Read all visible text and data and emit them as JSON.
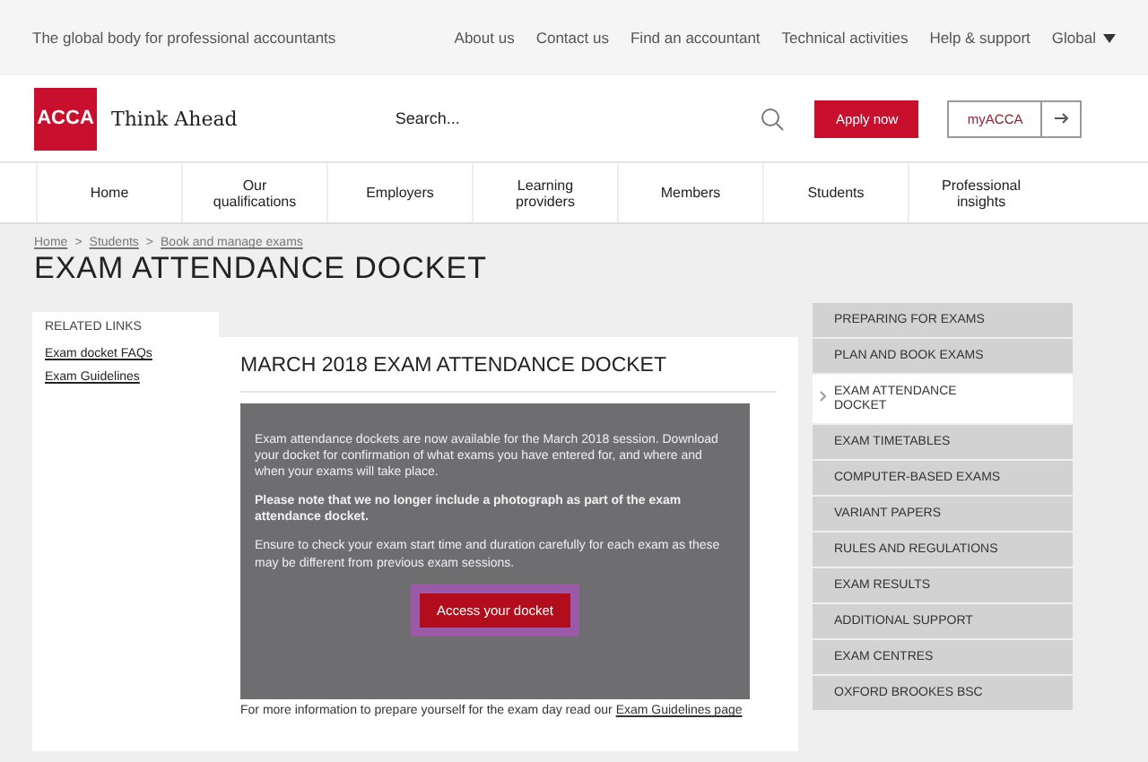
{
  "top_bar": {
    "tagline": "The global body for professional accountants",
    "links": [
      "About us",
      "Contact us",
      "Find an accountant",
      "Technical activities",
      "Help & support"
    ],
    "region": "Global"
  },
  "header": {
    "logo": "ACCA",
    "slogan": "Think Ahead",
    "search": {
      "placeholder": "Search..."
    },
    "apply_button": "Apply now",
    "account_button": "myACCA"
  },
  "nav": [
    "Home",
    "Our qualifications",
    "Employers",
    "Learning providers",
    "Members",
    "Students",
    "Professional insights"
  ],
  "breadcrumb": [
    "Home",
    "Students",
    "Book and manage exams"
  ],
  "breadcrumb_separator": ">",
  "page_title": "EXAM ATTENDANCE DOCKET",
  "related_links": {
    "title": "RELATED LINKS",
    "links": [
      "Exam docket FAQs",
      "Exam Guidelines"
    ]
  },
  "main": {
    "heading": "MARCH 2018 EXAM ATTENDANCE DOCKET",
    "paragraphs": [
      {
        "text": "Exam attendance dockets are now available for the March 2018 session. Download your docket for confirmation of what exams you have entered for, and where and when your exams will take place.",
        "bold": false
      },
      {
        "text": "Please note that we no longer include a photograph as part of the exam attendance docket.",
        "bold": true
      },
      {
        "text": "Ensure to check your exam start time and duration carefully for each exam as these may be different from previous exam sessions.",
        "bold": false
      }
    ],
    "button": "Access your docket",
    "footer_text": "For more information to prepare yourself for the exam day read our",
    "footer_link": "Exam Guidelines page"
  },
  "side_menu": [
    {
      "label": "PREPARING FOR EXAMS",
      "selected": false
    },
    {
      "label": "PLAN AND BOOK EXAMS",
      "selected": false
    },
    {
      "label": "EXAM ATTENDANCE DOCKET",
      "selected": true
    },
    {
      "label": "EXAM TIMETABLES",
      "selected": false
    },
    {
      "label": "COMPUTER-BASED EXAMS",
      "selected": false
    },
    {
      "label": "VARIANT PAPERS",
      "selected": false
    },
    {
      "label": "RULES AND REGULATIONS",
      "selected": false
    },
    {
      "label": "EXAM RESULTS",
      "selected": false
    },
    {
      "label": "ADDITIONAL SUPPORT",
      "selected": false
    },
    {
      "label": "EXAM CENTRES",
      "selected": false
    },
    {
      "label": "OXFORD BROOKES BSC",
      "selected": false
    }
  ]
}
